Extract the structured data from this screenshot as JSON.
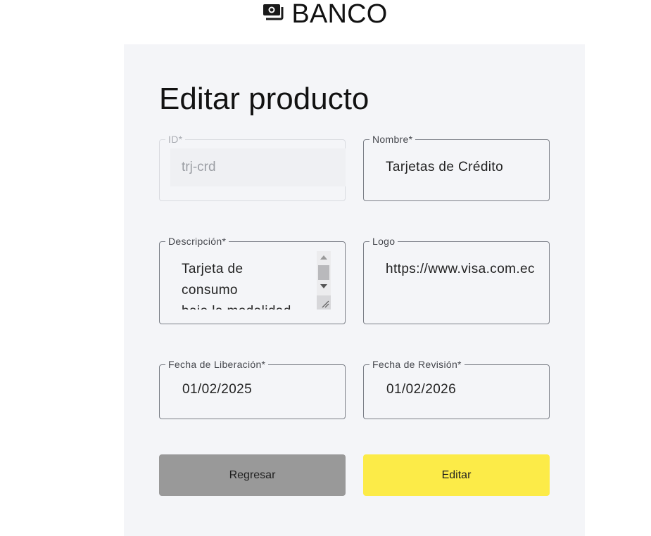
{
  "header": {
    "brand_icon": "money-icon",
    "title": "BANCO"
  },
  "page": {
    "title": "Editar producto"
  },
  "form": {
    "id": {
      "label": "ID*",
      "value": "trj-crd",
      "disabled": true
    },
    "nombre": {
      "label": "Nombre*",
      "value": "Tarjetas de Crédito"
    },
    "descripcion": {
      "label": "Descripción*",
      "lines": [
        "Tarjeta de",
        "consumo",
        "bajo la modalidad"
      ]
    },
    "logo": {
      "label": "Logo",
      "value": "https://www.visa.com.ec"
    },
    "fecha_liberacion": {
      "label": "Fecha de Liberación*",
      "value": "01/02/2025"
    },
    "fecha_revision": {
      "label": "Fecha de Revisión*",
      "value": "01/02/2026"
    }
  },
  "actions": {
    "back_label": "Regresar",
    "edit_label": "Editar"
  },
  "colors": {
    "card_bg": "#f4f5f8",
    "back_button": "#999999",
    "edit_button": "#fceb48"
  }
}
